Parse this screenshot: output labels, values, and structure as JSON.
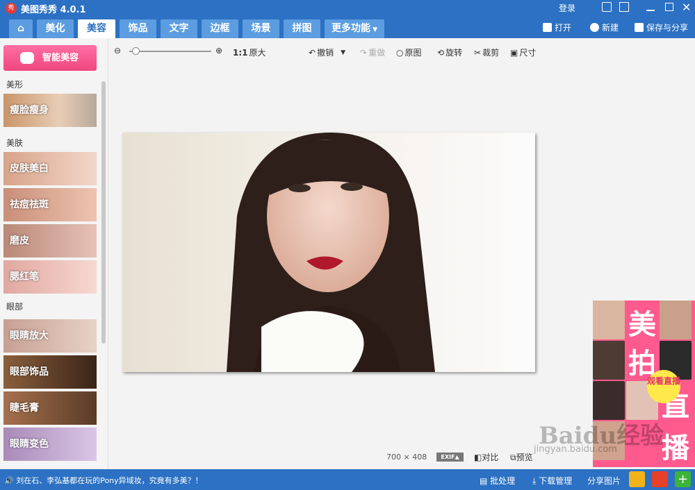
{
  "app": {
    "title": "美图秀秀 4.0.1",
    "logo_char": "秀",
    "login": "登录"
  },
  "nav": {
    "tabs": [
      "美化",
      "美容",
      "饰品",
      "文字",
      "边框",
      "场景",
      "拼图",
      "更多功能"
    ],
    "active": "美容",
    "actions": [
      "打开",
      "新建",
      "保存与分享"
    ]
  },
  "sidebar": {
    "smart": "智能美容",
    "sections": [
      "美形",
      "美肤",
      "眼部"
    ],
    "tools_shape": [
      "瘦脸瘦身"
    ],
    "tools_skin": [
      "皮肤美白",
      "祛痘祛斑",
      "磨皮",
      "腮红笔"
    ],
    "tools_eye": [
      "眼睛放大",
      "眼部饰品",
      "睫毛膏",
      "眼睛变色"
    ]
  },
  "toolbar": {
    "zoom_ratio": "1:1",
    "original_size": "原大",
    "undo": "撤销",
    "redo": "重做",
    "original": "原图",
    "rotate": "旋转",
    "crop": "裁剪",
    "resize": "尺寸"
  },
  "image": {
    "width": "700",
    "times": "×",
    "height": "408",
    "exif": "EXIF▲",
    "compare": "对比",
    "preview": "预览"
  },
  "ad": {
    "chars": [
      "美",
      "拍",
      "直",
      "播"
    ],
    "live": "观看直播"
  },
  "watermark": {
    "brand": "Baidu经验",
    "url": "jingyan.baidu.com"
  },
  "status": {
    "news": "刘在石、李弘基都在玩的Pony异域妆，究竟有多美？！",
    "batch": "批处理",
    "download": "下载管理",
    "share": "分享图片"
  },
  "colors": {
    "brand": "#2c71c3",
    "accent": "#f0467f"
  }
}
